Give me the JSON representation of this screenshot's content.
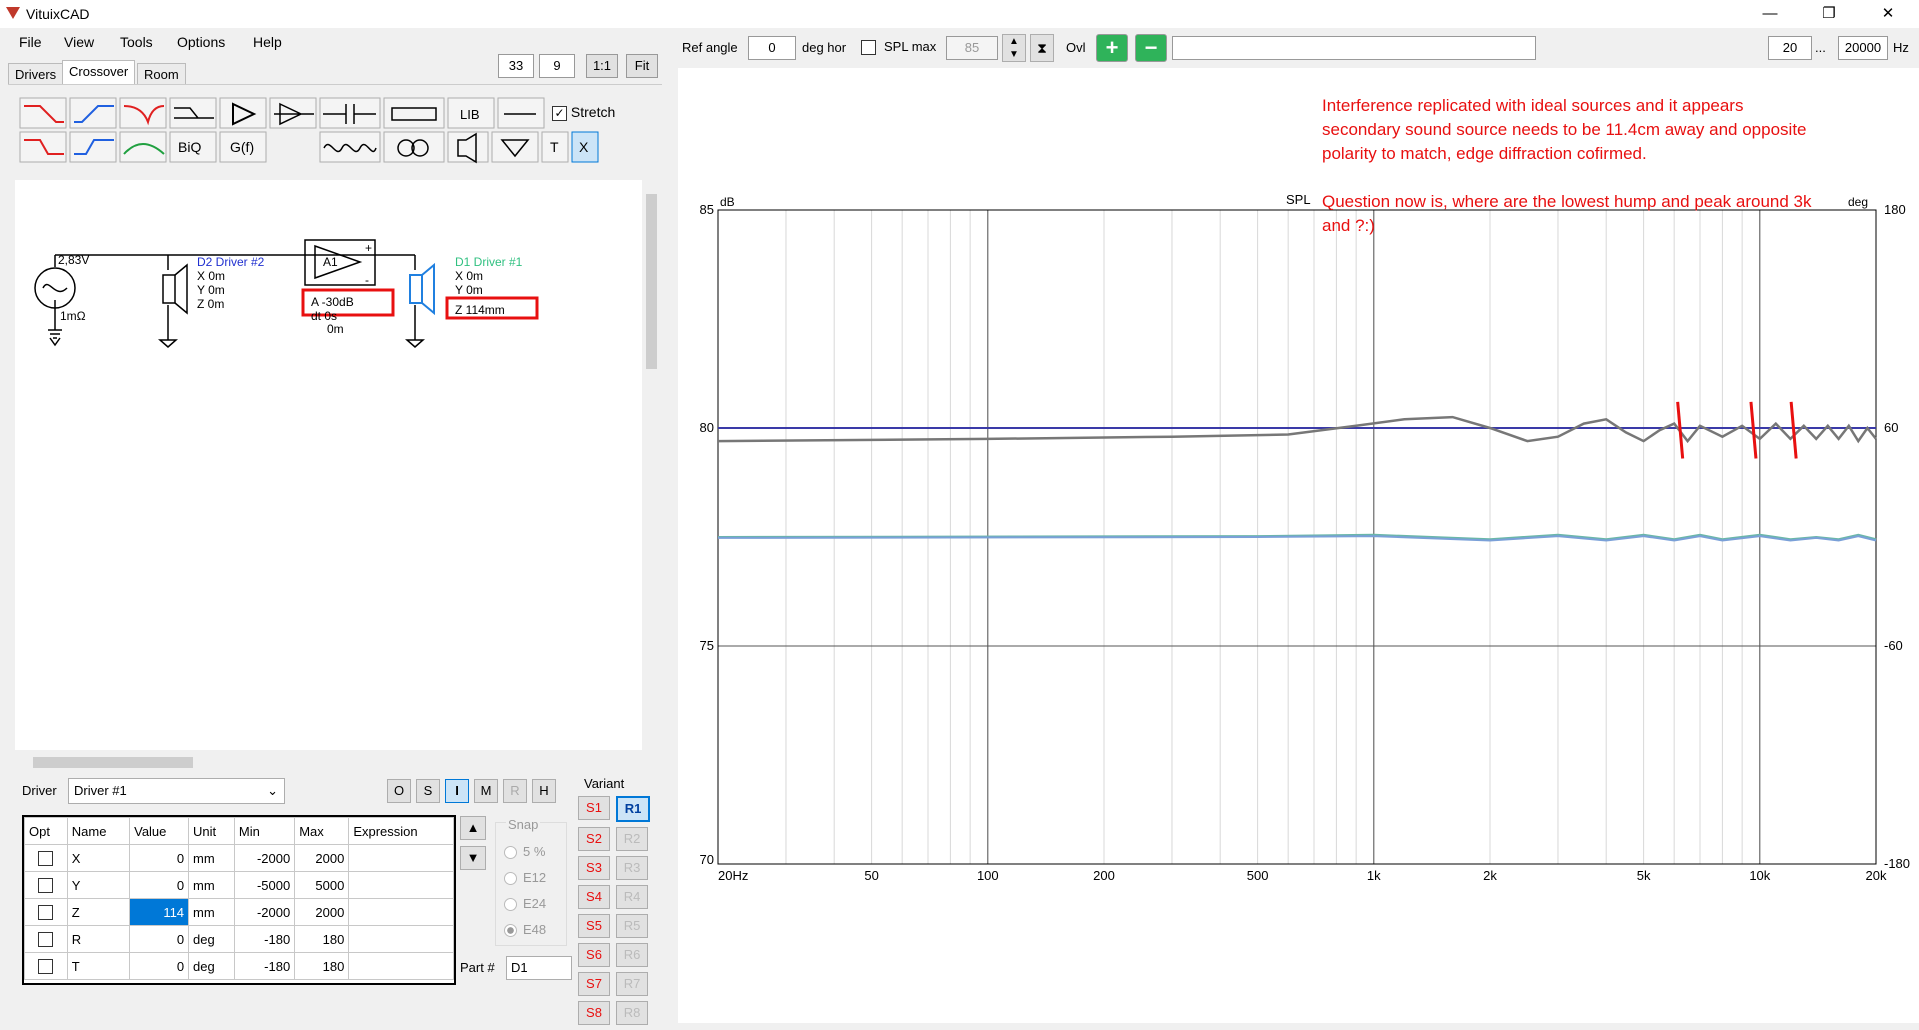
{
  "window": {
    "title": "VituixCAD",
    "minimize": "—",
    "restore": "❐",
    "close": "✕"
  },
  "menu": [
    "File",
    "View",
    "Tools",
    "Options",
    "Help"
  ],
  "tabs": [
    {
      "label": "Drivers"
    },
    {
      "label": "Crossover",
      "active": true
    },
    {
      "label": "Room"
    }
  ],
  "zoom": {
    "a": "33",
    "b": "9",
    "one_to_one": "1:1",
    "fit": "Fit"
  },
  "toolbar": {
    "stretch_label": "Stretch",
    "stretch_checked": true,
    "lib": "LIB",
    "biq": "BiQ",
    "gf": "G(f)",
    "t": "T",
    "x": "X"
  },
  "schematic": {
    "source_voltage": "2,83V",
    "source_impedance": "1mΩ",
    "d2": {
      "title": "D2 Driver #2",
      "x": "X 0m",
      "y": "Y 0m",
      "z": "Z 0m"
    },
    "amp": {
      "label": "A1",
      "gain": "A -30dB",
      "dt": "dt 0s",
      "offset": "0m",
      "plus": "+",
      "minus": "-"
    },
    "d1": {
      "title": "D1 Driver #1",
      "x": "X 0m",
      "y": "Y 0m",
      "z": "Z 114mm"
    }
  },
  "driver_select": {
    "label": "Driver",
    "value": "Driver #1"
  },
  "view_buttons": [
    "O",
    "S",
    "I",
    "M",
    "R",
    "H"
  ],
  "params": {
    "headers": [
      "Opt",
      "Name",
      "Value",
      "Unit",
      "Min",
      "Max",
      "Expression"
    ],
    "rows": [
      {
        "name": "X",
        "value": "0",
        "unit": "mm",
        "min": "-2000",
        "max": "2000"
      },
      {
        "name": "Y",
        "value": "0",
        "unit": "mm",
        "min": "-5000",
        "max": "5000"
      },
      {
        "name": "Z",
        "value": "114",
        "unit": "mm",
        "min": "-2000",
        "max": "2000"
      },
      {
        "name": "R",
        "value": "0",
        "unit": "deg",
        "min": "-180",
        "max": "180"
      },
      {
        "name": "T",
        "value": "0",
        "unit": "deg",
        "min": "-180",
        "max": "180"
      }
    ]
  },
  "snap": {
    "title": "Snap",
    "options": [
      "5 %",
      "E12",
      "E24",
      "E48"
    ],
    "selected": "E48"
  },
  "part": {
    "label": "Part #",
    "value": "D1"
  },
  "variant": {
    "title": "Variant",
    "s": [
      "S1",
      "S2",
      "S3",
      "S4",
      "S5",
      "S6",
      "S7",
      "S8"
    ],
    "r": [
      "R1",
      "R2",
      "R3",
      "R4",
      "R5",
      "R6",
      "R7",
      "R8"
    ]
  },
  "graph_toolbar": {
    "ref_angle_label": "Ref angle",
    "ref_angle_value": "0",
    "deg_hor": "deg hor",
    "spl_max_label": "SPL max",
    "spl_max_value": "85",
    "ovl": "Ovl",
    "f_min": "20",
    "ellipsis": "...",
    "f_max": "20000",
    "hz": "Hz"
  },
  "notes": [
    "Interference replicated with ideal sources and it appears",
    "secondary sound  source needs to be 11.4cm away and opposite",
    "polarity to match, edge diffraction cofirmed.",
    "Question now is, where are the lowest hump and peak around 3k",
    "and ?:)"
  ],
  "chart_data": {
    "type": "line",
    "title": "SPL",
    "ylabel": "dB",
    "y2label": "deg",
    "x_scale": "log",
    "xlim": [
      20,
      20000
    ],
    "ylim": [
      70,
      85
    ],
    "y2lim": [
      -180,
      180
    ],
    "x_ticks": [
      "20Hz",
      "50",
      "100",
      "200",
      "500",
      "1k",
      "2k",
      "5k",
      "10k",
      "20k"
    ],
    "y_ticks": [
      "70",
      "75",
      "80",
      "85"
    ],
    "y2_ticks": [
      "-180",
      "-60",
      "60",
      "180"
    ],
    "grid": true,
    "series": [
      {
        "color": "#3a3aa8",
        "x": [
          20,
          20000
        ],
        "y": [
          80.0,
          80.0
        ]
      },
      {
        "color": "#777777",
        "x": [
          20,
          100,
          300,
          600,
          900,
          1200,
          1600,
          2000,
          2500,
          3000,
          3500,
          4000,
          4500,
          5000,
          5500,
          6000,
          6500,
          7000,
          8000,
          9000,
          10000,
          11000,
          12000,
          13000,
          14000,
          15000,
          16000,
          17000,
          18000,
          19000,
          20000
        ],
        "y": [
          79.7,
          79.75,
          79.8,
          79.85,
          80.05,
          80.2,
          80.25,
          80.0,
          79.7,
          79.8,
          80.1,
          80.2,
          79.9,
          79.7,
          79.95,
          80.1,
          79.7,
          80.05,
          79.8,
          80.05,
          79.75,
          80.1,
          79.75,
          80.05,
          79.75,
          80.05,
          79.75,
          80.05,
          79.7,
          80.0,
          79.75
        ]
      },
      {
        "color": "#6ab7a8",
        "x": [
          20,
          500,
          1000,
          2000,
          3000,
          4000,
          5000,
          6000,
          7000,
          8000,
          10000,
          12000,
          14000,
          16000,
          18000,
          20000
        ],
        "y": [
          77.5,
          77.52,
          77.55,
          77.45,
          77.55,
          77.45,
          77.55,
          77.45,
          77.55,
          77.45,
          77.55,
          77.45,
          77.5,
          77.45,
          77.55,
          77.45
        ]
      },
      {
        "color": "#7aa0d8",
        "x": [
          20,
          500,
          1000,
          2000,
          3000,
          4000,
          5000,
          6000,
          7000,
          8000,
          10000,
          12000,
          14000,
          16000,
          18000,
          20000
        ],
        "y": [
          77.48,
          77.5,
          77.52,
          77.42,
          77.52,
          77.42,
          77.52,
          77.42,
          77.52,
          77.42,
          77.52,
          77.42,
          77.48,
          77.42,
          77.52,
          77.42
        ]
      }
    ],
    "markers": [
      6200,
      9600,
      12200
    ],
    "marker_color": "#e81010"
  }
}
